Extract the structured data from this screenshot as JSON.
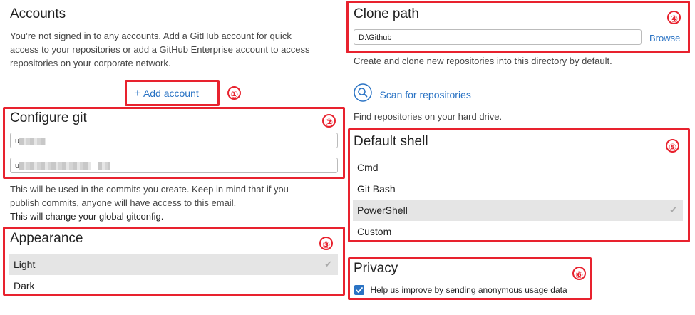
{
  "accounts": {
    "title": "Accounts",
    "description_lines": [
      "You’re not signed in to any accounts. Add a GitHub account for quick",
      "access to your repositories or add a GitHub Enterprise account to access",
      "repositories on your corporate network."
    ],
    "add_account_label": "Add account"
  },
  "configure_git": {
    "title": "Configure git",
    "name_prefix": "u",
    "email_prefix": "u",
    "note_lines": [
      "This will be used in the commits you create. Keep in mind that if you",
      "publish commits, anyone will have access to this email."
    ],
    "note2": "This will change your global gitconfig."
  },
  "appearance": {
    "title": "Appearance",
    "options": [
      "Light",
      "Dark"
    ],
    "selected": "Light"
  },
  "clone_path": {
    "title": "Clone path",
    "value": "D:\\Github",
    "browse_label": "Browse",
    "description": "Create and clone new repositories into this directory by default."
  },
  "scan": {
    "label": "Scan for repositories",
    "description": "Find repositories on your hard drive."
  },
  "default_shell": {
    "title": "Default shell",
    "options": [
      "Cmd",
      "Git Bash",
      "PowerShell",
      "Custom"
    ],
    "selected": "PowerShell"
  },
  "privacy": {
    "title": "Privacy",
    "checkbox_label": "Help us improve by sending anonymous usage data",
    "checked": true
  },
  "badges": [
    "①",
    "②",
    "③",
    "④",
    "⑤",
    "⑥"
  ],
  "colors": {
    "annotation_red": "#e8222e",
    "link_blue": "#2a73c4",
    "selected_bg": "#e5e5e5",
    "checkbox_blue": "#2a73c4"
  }
}
